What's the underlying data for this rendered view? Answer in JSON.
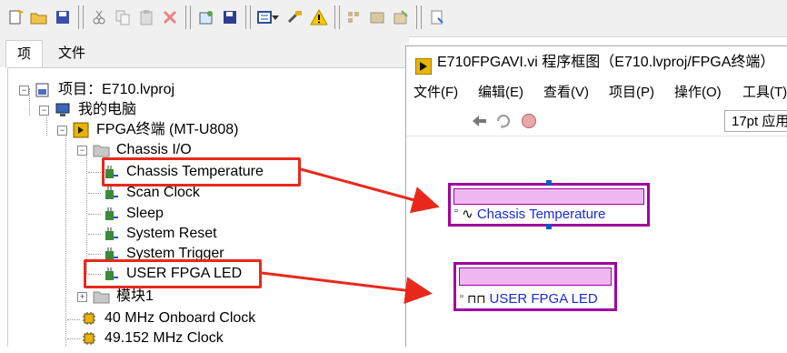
{
  "toolbar": {
    "buttons": [
      "new-item-icon",
      "open-icon",
      "save-all-icon",
      "cut-icon",
      "copy-icon",
      "paste-icon",
      "delete-icon",
      "properties-icon",
      "save-icon",
      "view-options-icon",
      "dropdown-icon",
      "build-icon",
      "warning-icon",
      "tool1-icon",
      "tool2-icon",
      "tool3-icon",
      "help-icon"
    ]
  },
  "tabs": [
    "项",
    "文件"
  ],
  "tree": {
    "project": "项目：E710.lvproj",
    "computer": "我的电脑",
    "fpga": "FPGA终端 (MT-U808)",
    "chassis_io": "Chassis I/O",
    "chassis_items": [
      "Chassis Temperature",
      "Scan Clock",
      "Sleep",
      "System Reset",
      "System Trigger",
      "USER FPGA LED"
    ],
    "module": "模块1",
    "clocks": [
      "40 MHz Onboard Clock",
      "49.152 MHz Clock"
    ]
  },
  "window": {
    "title": "E710FPGAVI.vi 程序框图（E710.lvproj/FPGA终端）",
    "menu": [
      "文件(F)",
      "编辑(E)",
      "查看(V)",
      "项目(P)",
      "操作(O)",
      "工具(T)"
    ],
    "font_field": "17pt 应用"
  },
  "nodes": {
    "chassis_temperature": "Chassis Temperature",
    "user_fpga_led": "USER FPGA LED"
  },
  "colors": {
    "highlight": "#e8291c",
    "node_border": "#a000a0",
    "node_label": "#1a2bd6"
  }
}
